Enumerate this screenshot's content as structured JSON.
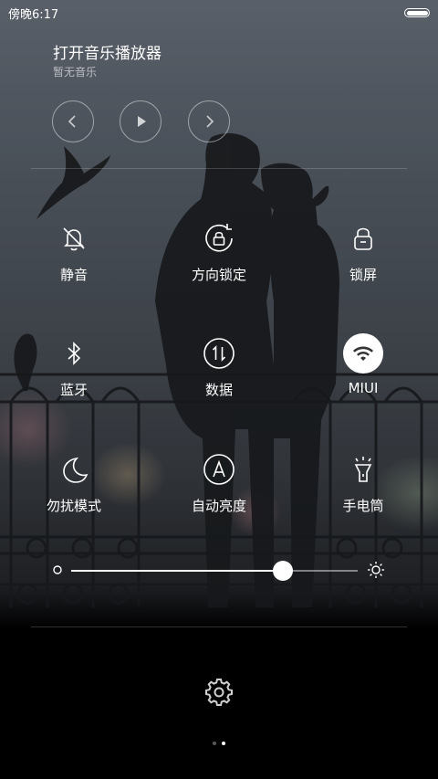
{
  "status_bar": {
    "time": "傍晚6:17",
    "battery_level": 1.0
  },
  "music": {
    "title": "打开音乐播放器",
    "subtitle": "暂无音乐",
    "prev_icon": "chevron-left-icon",
    "play_icon": "play-icon",
    "next_icon": "chevron-right-icon"
  },
  "toggles": [
    {
      "label": "静音",
      "icon": "bell-off-icon",
      "on": false
    },
    {
      "label": "方向锁定",
      "icon": "rotation-lock-icon",
      "on": false
    },
    {
      "label": "锁屏",
      "icon": "lock-icon",
      "on": false
    },
    {
      "label": "蓝牙",
      "icon": "bluetooth-icon",
      "on": false
    },
    {
      "label": "数据",
      "icon": "mobile-data-icon",
      "on": false
    },
    {
      "label": "MIUI",
      "icon": "wifi-icon",
      "on": true
    },
    {
      "label": "勿扰模式",
      "icon": "moon-icon",
      "on": false
    },
    {
      "label": "自动亮度",
      "icon": "auto-brightness-icon",
      "on": false
    },
    {
      "label": "手电筒",
      "icon": "flashlight-icon",
      "on": false
    }
  ],
  "brightness": {
    "level": 0.74
  },
  "settings_icon": "gear-icon",
  "pager": {
    "pages": 2,
    "current": 2
  }
}
